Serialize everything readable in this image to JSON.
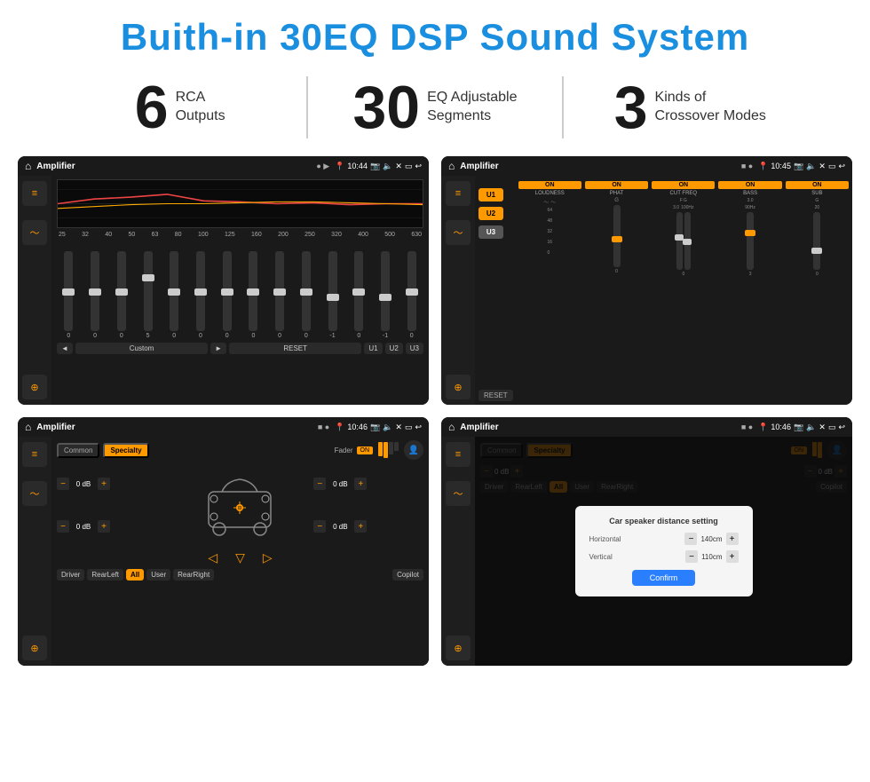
{
  "header": {
    "title": "Buith-in 30EQ DSP Sound System"
  },
  "stats": [
    {
      "number": "6",
      "label": "RCA\nOutputs"
    },
    {
      "number": "30",
      "label": "EQ Adjustable\nSegments"
    },
    {
      "number": "3",
      "label": "Kinds of\nCrossover Modes"
    }
  ],
  "screens": [
    {
      "id": "eq-screen",
      "title": "Amplifier",
      "time": "10:44",
      "type": "eq"
    },
    {
      "id": "crossover-screen",
      "title": "Amplifier",
      "time": "10:45",
      "type": "crossover"
    },
    {
      "id": "fader-screen",
      "title": "Amplifier",
      "time": "10:46",
      "type": "fader"
    },
    {
      "id": "distance-screen",
      "title": "Amplifier",
      "time": "10:46",
      "type": "distance",
      "dialog": {
        "title": "Car speaker distance setting",
        "horizontal": "140cm",
        "vertical": "110cm",
        "confirm": "Confirm"
      }
    }
  ],
  "eq": {
    "frequencies": [
      "25",
      "32",
      "40",
      "50",
      "63",
      "80",
      "100",
      "125",
      "160",
      "200",
      "250",
      "320",
      "400",
      "500",
      "630"
    ],
    "values": [
      "0",
      "0",
      "0",
      "5",
      "0",
      "0",
      "0",
      "0",
      "0",
      "0",
      "0",
      "-1",
      "0",
      "-1"
    ],
    "buttons": [
      "◄",
      "Custom",
      "►",
      "RESET",
      "U1",
      "U2",
      "U3"
    ]
  },
  "crossover": {
    "channels": [
      {
        "name": "LOUDNESS",
        "on": true
      },
      {
        "name": "PHAT",
        "on": true
      },
      {
        "name": "CUT FREQ",
        "on": true
      },
      {
        "name": "BASS",
        "on": true
      },
      {
        "name": "SUB",
        "on": true
      }
    ],
    "uButtons": [
      "U1",
      "U2",
      "U3"
    ],
    "resetBtn": "RESET"
  },
  "fader": {
    "modes": [
      "Common",
      "Specialty"
    ],
    "faderLabel": "Fader",
    "onLabel": "ON",
    "speakers": {
      "frontLeft": "0 dB",
      "frontRight": "0 dB",
      "rearLeft": "0 dB",
      "rearRight": "0 dB"
    },
    "bottomButtons": [
      "Driver",
      "RearLeft",
      "All",
      "User",
      "RearRight",
      "Copilot"
    ]
  },
  "distance": {
    "modes": [
      "Common",
      "Specialty"
    ],
    "dialog": {
      "title": "Car speaker distance setting",
      "horizontalLabel": "Horizontal",
      "horizontalValue": "140cm",
      "verticalLabel": "Vertical",
      "verticalValue": "110cm",
      "confirmLabel": "Confirm"
    },
    "speakers": {
      "left": "0 dB",
      "right": "0 dB"
    },
    "bottomButtons": [
      "Driver",
      "RearLeft",
      "All",
      "User",
      "RearRight",
      "Copilot"
    ]
  }
}
